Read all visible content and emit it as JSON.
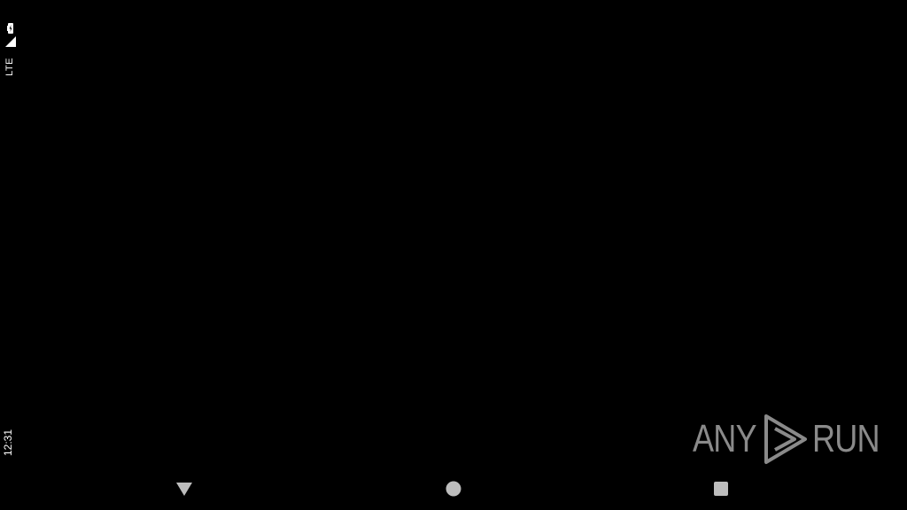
{
  "status_bar": {
    "network_type": "LTE",
    "clock": "12:31",
    "icons": [
      "battery-charging-icon",
      "cell-signal-icon"
    ]
  },
  "watermark": {
    "text_left": "ANY",
    "text_right": "RUN",
    "logo_icon": "play-triangle-logo-icon",
    "color": "#8a8a8a"
  },
  "navigation_bar": {
    "buttons": [
      {
        "name": "back",
        "icon": "back-triangle-icon"
      },
      {
        "name": "home",
        "icon": "home-circle-icon"
      },
      {
        "name": "recents",
        "icon": "recents-square-icon"
      }
    ],
    "icon_color": "#bdbdbd"
  },
  "colors": {
    "background": "#000000",
    "status_text": "#ffffff"
  }
}
